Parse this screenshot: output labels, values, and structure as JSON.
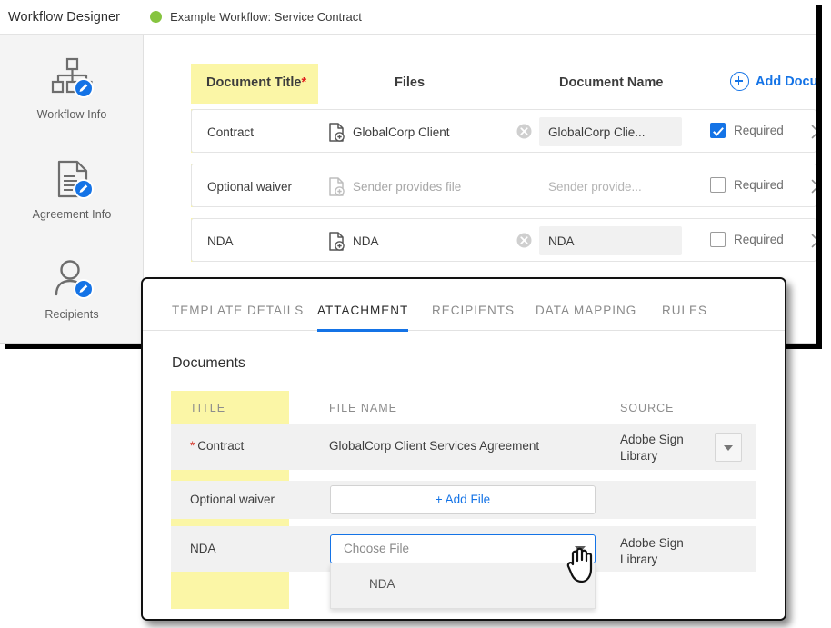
{
  "app": {
    "title": "Workflow Designer",
    "workflow_name": "Example Workflow: Service Contract",
    "status_color": "#86c440"
  },
  "sidebar": {
    "items": [
      {
        "label": "Workflow Info",
        "icon": "workflow-hierarchy-edit-icon"
      },
      {
        "label": "Agreement Info",
        "icon": "document-edit-icon"
      },
      {
        "label": "Recipients",
        "icon": "person-edit-icon"
      }
    ]
  },
  "documents_table": {
    "headers": {
      "title": "Document Title",
      "title_required_marker": "*",
      "files": "Files",
      "document_name": "Document Name",
      "add_document": "Add Document"
    },
    "rows": [
      {
        "title": "Contract",
        "file": "GlobalCorp Client",
        "file_placeholder": false,
        "has_clear": true,
        "document_name": "GlobalCorp Clie...",
        "document_name_placeholder": false,
        "required": true,
        "required_label": "Required"
      },
      {
        "title": "Optional waiver",
        "file": "Sender provides file",
        "file_placeholder": true,
        "has_clear": false,
        "document_name": "Sender provide...",
        "document_name_placeholder": true,
        "required": false,
        "required_label": "Required"
      },
      {
        "title": "NDA",
        "file": "NDA",
        "file_placeholder": false,
        "has_clear": true,
        "document_name": "NDA",
        "document_name_placeholder": false,
        "required": false,
        "required_label": "Required"
      }
    ]
  },
  "modal": {
    "tabs": [
      {
        "label": "TEMPLATE DETAILS",
        "active": false
      },
      {
        "label": "ATTACHMENT",
        "active": true
      },
      {
        "label": "RECIPIENTS",
        "active": false
      },
      {
        "label": "DATA MAPPING",
        "active": false
      },
      {
        "label": "RULES",
        "active": false
      }
    ],
    "section_title": "Documents",
    "table": {
      "headers": {
        "title": "TITLE",
        "file_name": "FILE NAME",
        "source": "SOURCE"
      },
      "rows": [
        {
          "title": "Contract",
          "required_star": "*",
          "file_name": "GlobalCorp Client Services Agreement",
          "source": "Adobe Sign Library",
          "has_source_caret": true
        },
        {
          "title": "Optional waiver",
          "required_star": "",
          "add_file_label": "+ Add File",
          "source": "",
          "has_source_caret": false
        },
        {
          "title": "NDA",
          "required_star": "",
          "choose_file_placeholder": "Choose File",
          "source": "Adobe Sign Library",
          "has_source_caret": false
        }
      ]
    },
    "dropdown": {
      "options": [
        "NDA"
      ]
    }
  },
  "colors": {
    "accent_blue": "#1473e6",
    "highlight_yellow": "#fbf6a6",
    "status_green": "#86c440",
    "required_red": "#e02020"
  }
}
